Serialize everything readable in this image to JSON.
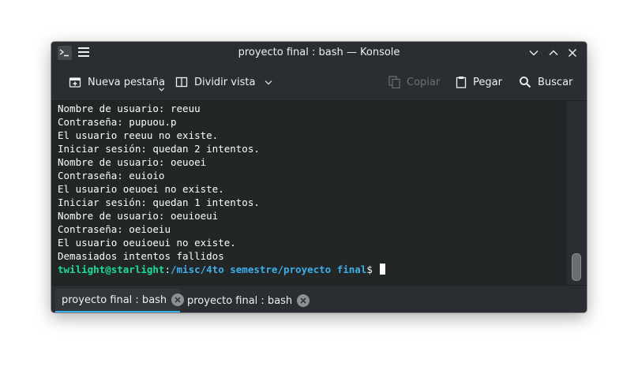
{
  "window": {
    "title": "proyecto final : bash — Konsole"
  },
  "toolbar": {
    "new_tab_label": "Nueva pestaña",
    "split_view_label": "Dividir vista",
    "copy_label": "Copiar",
    "paste_label": "Pegar",
    "search_label": "Buscar"
  },
  "terminal": {
    "lines": [
      "Nombre de usuario: reeuu",
      "Contraseña: pupuou.p",
      "El usuario reeuu no existe.",
      "Iniciar sesión: quedan 2 intentos.",
      "Nombre de usuario: oeuoei",
      "Contraseña: euioio",
      "El usuario oeuoei no existe.",
      "Iniciar sesión: quedan 1 intentos.",
      "Nombre de usuario: oeuioeui",
      "Contraseña: oeioeiu",
      "El usuario oeuioeui no existe.",
      "Demasiados intentos fallidos"
    ],
    "prompt": {
      "user_host": "twilight@starlight",
      "separator": ":",
      "path": "/misc/4to semestre/proyecto final",
      "symbol": "$ "
    }
  },
  "tabs": [
    {
      "label": "proyecto final : bash",
      "active": true
    },
    {
      "label": "proyecto final : bash",
      "active": false
    }
  ],
  "colors": {
    "accent": "#3daee9",
    "prompt_user": "#1cdc9a",
    "terminal_bg": "#232627"
  }
}
